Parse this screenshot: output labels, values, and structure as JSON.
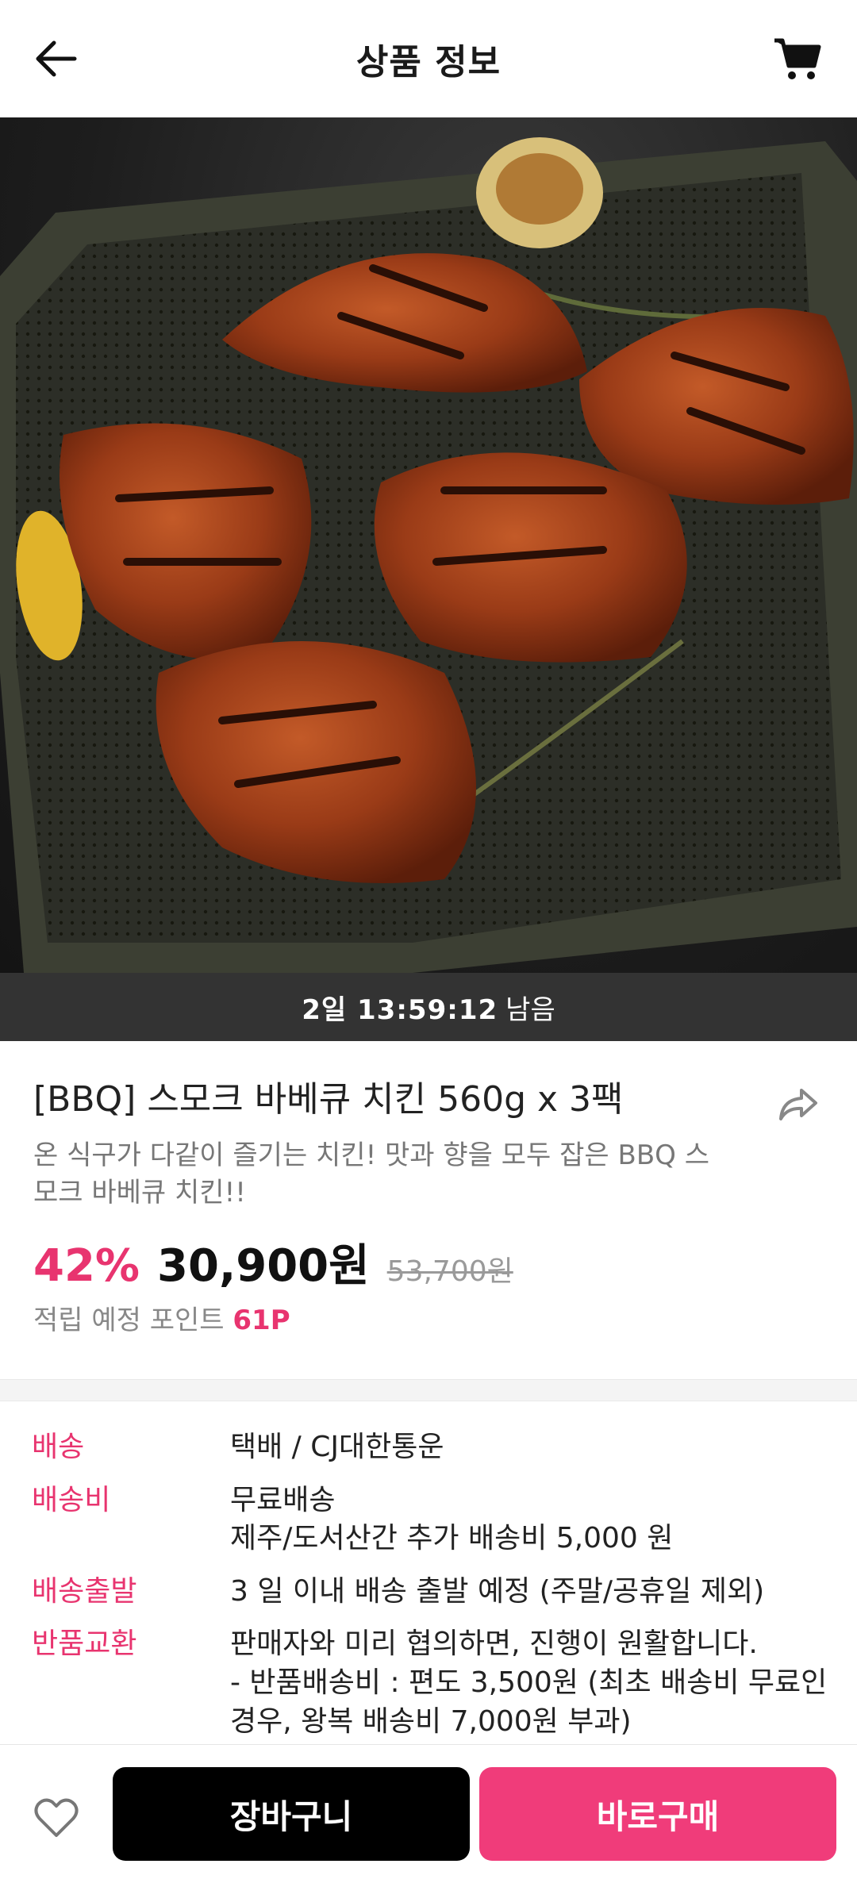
{
  "header": {
    "title": "상품 정보",
    "back_icon": "arrow-left-icon",
    "cart_icon": "cart-icon"
  },
  "hero": {
    "image": "product-photo"
  },
  "timer": {
    "time": "2일 13:59:12",
    "suffix": "남음"
  },
  "product": {
    "name": "[BBQ] 스모크 바베큐 치킨 560g x 3팩",
    "description": "온 식구가 다같이 즐기는 치킨! 맛과 향을 모두 잡은 BBQ 스모크 바베큐 치킨!!",
    "discount": "42%",
    "price": "30,900원",
    "original_price": "53,700원",
    "points_label": "적립 예정 포인트",
    "points_value": "61P",
    "share_icon": "share-icon"
  },
  "shipping": {
    "rows": [
      {
        "label": "배송",
        "lines": [
          "택배 / CJ대한통운"
        ]
      },
      {
        "label": "배송비",
        "lines": [
          "무료배송",
          "제주/도서산간 추가 배송비 5,000 원"
        ]
      },
      {
        "label": "배송출발",
        "lines": [
          "3 일 이내 배송 출발 예정 (주말/공휴일 제외)"
        ]
      },
      {
        "label": "반품교환",
        "lines": [
          "판매자와 미리 협의하면, 진행이 원활합니다.",
          "- 반품배송비 : 편도 3,500원 (최초 배송비 무료인",
          "경우, 왕복 배송비 7,000원 부과)"
        ]
      }
    ]
  },
  "actions": {
    "wishlist_icon": "heart-icon",
    "cart_button": "장바구니",
    "buy_button": "바로구매"
  },
  "colors": {
    "accent": "#e8346f",
    "buy": "#f03c7a",
    "timer_bg": "#333333"
  }
}
